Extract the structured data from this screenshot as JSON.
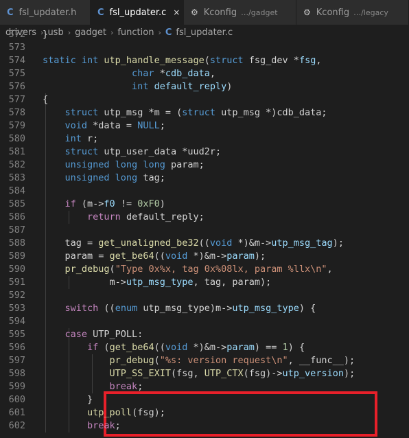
{
  "tabs": [
    {
      "icon": "C",
      "label": "fsl_updater.h",
      "active": false
    },
    {
      "icon": "C",
      "label": "fsl_updater.c",
      "active": true,
      "close": "×"
    },
    {
      "icon": "⚙",
      "label": "Kconfig",
      "desc": "…/gadget",
      "active": false
    },
    {
      "icon": "⚙",
      "label": "Kconfig",
      "desc": "…/legacy",
      "active": false
    }
  ],
  "breadcrumb": {
    "parts": [
      "drivers",
      "usb",
      "gadget",
      "function"
    ],
    "file_icon": "C",
    "file": "fsl_updater.c",
    "separator": "›"
  },
  "code": {
    "line_numbers": [
      "572",
      "573",
      "574",
      "575",
      "576",
      "577",
      "578",
      "579",
      "580",
      "581",
      "582",
      "583",
      "584",
      "585",
      "586",
      "587",
      "588",
      "589",
      "590",
      "591",
      "592",
      "593",
      "594",
      "595",
      "596",
      "597",
      "598",
      "599",
      "600",
      "601",
      "602"
    ],
    "lines": [
      [
        [
          "pl",
          "}"
        ]
      ],
      [],
      [
        [
          "kw",
          "static "
        ],
        [
          "kw",
          "int "
        ],
        [
          "fn",
          "utp_handle_message"
        ],
        [
          "pl",
          "("
        ],
        [
          "kw",
          "struct "
        ],
        [
          "pl",
          "fsg_dev *"
        ],
        [
          "var",
          "fsg"
        ],
        [
          "pl",
          ","
        ]
      ],
      [
        [
          "pl",
          "                "
        ],
        [
          "kw",
          "char "
        ],
        [
          "pl",
          "*"
        ],
        [
          "var",
          "cdb_data"
        ],
        [
          "pl",
          ","
        ]
      ],
      [
        [
          "pl",
          "                "
        ],
        [
          "kw",
          "int "
        ],
        [
          "var",
          "default_reply"
        ],
        [
          "pl",
          ")"
        ]
      ],
      [
        [
          "pl",
          "{"
        ]
      ],
      [
        [
          "pl",
          "    "
        ],
        [
          "kw",
          "struct "
        ],
        [
          "pl",
          "utp_msg *m = ("
        ],
        [
          "kw",
          "struct "
        ],
        [
          "pl",
          "utp_msg *)cdb_data;"
        ]
      ],
      [
        [
          "pl",
          "    "
        ],
        [
          "kw",
          "void "
        ],
        [
          "pl",
          "*data = "
        ],
        [
          "kw",
          "NULL"
        ],
        [
          "pl",
          ";"
        ]
      ],
      [
        [
          "pl",
          "    "
        ],
        [
          "kw",
          "int "
        ],
        [
          "pl",
          "r;"
        ]
      ],
      [
        [
          "pl",
          "    "
        ],
        [
          "kw",
          "struct "
        ],
        [
          "pl",
          "utp_user_data *uud2r;"
        ]
      ],
      [
        [
          "pl",
          "    "
        ],
        [
          "kw",
          "unsigned "
        ],
        [
          "kw",
          "long "
        ],
        [
          "kw",
          "long "
        ],
        [
          "pl",
          "param;"
        ]
      ],
      [
        [
          "pl",
          "    "
        ],
        [
          "kw",
          "unsigned "
        ],
        [
          "kw",
          "long "
        ],
        [
          "pl",
          "tag;"
        ]
      ],
      [],
      [
        [
          "pl",
          "    "
        ],
        [
          "ctl",
          "if "
        ],
        [
          "pl",
          "(m->"
        ],
        [
          "var",
          "f0"
        ],
        [
          "pl",
          " != "
        ],
        [
          "num",
          "0xF0"
        ],
        [
          "pl",
          ")"
        ]
      ],
      [
        [
          "pl",
          "        "
        ],
        [
          "ctl",
          "return "
        ],
        [
          "pl",
          "default_reply;"
        ]
      ],
      [],
      [
        [
          "pl",
          "    tag = "
        ],
        [
          "fn",
          "get_unaligned_be32"
        ],
        [
          "pl",
          "(("
        ],
        [
          "kw",
          "void "
        ],
        [
          "pl",
          "*)&m->"
        ],
        [
          "var",
          "utp_msg_tag"
        ],
        [
          "pl",
          ");"
        ]
      ],
      [
        [
          "pl",
          "    param = "
        ],
        [
          "fn",
          "get_be64"
        ],
        [
          "pl",
          "(("
        ],
        [
          "kw",
          "void "
        ],
        [
          "pl",
          "*)&m->"
        ],
        [
          "var",
          "param"
        ],
        [
          "pl",
          ");"
        ]
      ],
      [
        [
          "pl",
          "    "
        ],
        [
          "fn",
          "pr_debug"
        ],
        [
          "pl",
          "("
        ],
        [
          "str",
          "\"Type 0x%x, tag 0x%08lx, param %llx\\n\""
        ],
        [
          "pl",
          ","
        ]
      ],
      [
        [
          "pl",
          "            m->"
        ],
        [
          "var",
          "utp_msg_type"
        ],
        [
          "pl",
          ", tag, param);"
        ]
      ],
      [],
      [
        [
          "pl",
          "    "
        ],
        [
          "ctl",
          "switch "
        ],
        [
          "pl",
          "(("
        ],
        [
          "kw",
          "enum "
        ],
        [
          "pl",
          "utp_msg_type)m->"
        ],
        [
          "var",
          "utp_msg_type"
        ],
        [
          "pl",
          ") {"
        ]
      ],
      [],
      [
        [
          "pl",
          "    "
        ],
        [
          "ctl",
          "case "
        ],
        [
          "pl",
          "UTP_POLL:"
        ]
      ],
      [
        [
          "pl",
          "        "
        ],
        [
          "ctl",
          "if "
        ],
        [
          "pl",
          "("
        ],
        [
          "fn",
          "get_be64"
        ],
        [
          "pl",
          "(("
        ],
        [
          "kw",
          "void "
        ],
        [
          "pl",
          "*)&m->"
        ],
        [
          "var",
          "param"
        ],
        [
          "pl",
          ") == "
        ],
        [
          "num",
          "1"
        ],
        [
          "pl",
          ") {"
        ]
      ],
      [
        [
          "pl",
          "            "
        ],
        [
          "fn",
          "pr_debug"
        ],
        [
          "pl",
          "("
        ],
        [
          "str",
          "\"%s: version request\\n\""
        ],
        [
          "pl",
          ", __func__);"
        ]
      ],
      [
        [
          "pl",
          "            "
        ],
        [
          "fn",
          "UTP_SS_EXIT"
        ],
        [
          "pl",
          "(fsg, "
        ],
        [
          "fn",
          "UTP_CTX"
        ],
        [
          "pl",
          "(fsg)->"
        ],
        [
          "var",
          "utp_version"
        ],
        [
          "pl",
          ");"
        ]
      ],
      [
        [
          "pl",
          "            "
        ],
        [
          "ctl",
          "break"
        ],
        [
          "pl",
          ";"
        ]
      ],
      [
        [
          "pl",
          "        }"
        ]
      ],
      [
        [
          "pl",
          "        "
        ],
        [
          "fn",
          "utp_poll"
        ],
        [
          "pl",
          "(fsg);"
        ]
      ],
      [
        [
          "pl",
          "        "
        ],
        [
          "ctl",
          "break"
        ],
        [
          "pl",
          ";"
        ]
      ]
    ]
  },
  "colors": {
    "highlight_box": "#e8202a",
    "background": "#1e1e1e",
    "keyword": "#569cd6",
    "function": "#dcdcaa",
    "string": "#ce9178"
  }
}
